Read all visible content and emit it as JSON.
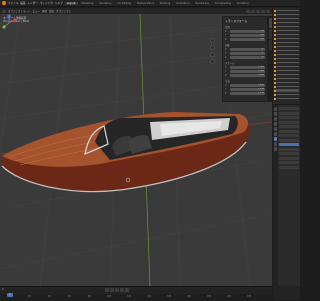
{
  "menubar": {
    "items": [
      "ファイル",
      "編集",
      "レンダー",
      "ウィンドウ",
      "ヘルプ"
    ],
    "workspaces": [
      "Layout",
      "Modeling",
      "Sculpting",
      "UV Editing",
      "Texture Paint",
      "Shading",
      "Animation",
      "Rendering",
      "Compositing",
      "Scripting"
    ],
    "active_workspace": "Layout",
    "scene": "Scene"
  },
  "viewport": {
    "header": [
      "オブジェクトモード",
      "ビュー",
      "選択",
      "追加",
      "オブジェクト"
    ],
    "info_line1": "ユーザー・透視投影",
    "info_line2": "(0) Collection | Boat"
  },
  "sidebar": {
    "title": "トランスフォーム",
    "location_label": "位置",
    "rotation_label": "回転",
    "scale_label": "スケール",
    "dimensions_label": "寸法",
    "axes": [
      "X",
      "Y",
      "Z"
    ],
    "location": [
      "0 m",
      "0 m",
      "0 m"
    ],
    "rotation": [
      "0°",
      "0°",
      "0°"
    ],
    "scale": [
      "1.000",
      "1.000",
      "1.000"
    ],
    "dimensions": [
      "2.4 m",
      "7.3 m",
      "1.2 m"
    ]
  },
  "timeline": {
    "frame": "0",
    "ticks": [
      "0",
      "20",
      "40",
      "60",
      "80",
      "100",
      "120",
      "140",
      "160",
      "180",
      "200",
      "220",
      "240"
    ]
  },
  "colors": {
    "hull": "#8a3a22",
    "deck": "#a5522e",
    "accent": "#4772b3",
    "orange": "#e87d0d"
  },
  "icons": [
    "blender-logo-icon",
    "play-icon",
    "jump-start-icon",
    "jump-end-icon",
    "camera-icon",
    "hand-icon",
    "zoom-icon",
    "grid-icon"
  ]
}
